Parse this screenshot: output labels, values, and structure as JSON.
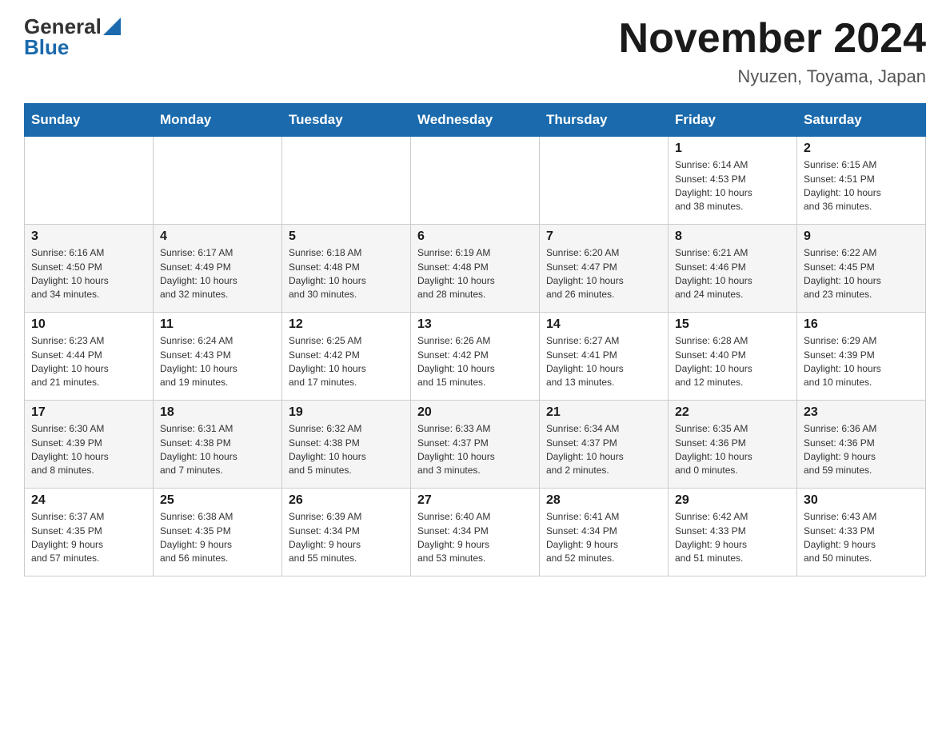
{
  "header": {
    "logo_general": "General",
    "logo_blue": "Blue",
    "month_title": "November 2024",
    "location": "Nyuzen, Toyama, Japan"
  },
  "days_of_week": [
    "Sunday",
    "Monday",
    "Tuesday",
    "Wednesday",
    "Thursday",
    "Friday",
    "Saturday"
  ],
  "weeks": [
    [
      {
        "day": "",
        "info": ""
      },
      {
        "day": "",
        "info": ""
      },
      {
        "day": "",
        "info": ""
      },
      {
        "day": "",
        "info": ""
      },
      {
        "day": "",
        "info": ""
      },
      {
        "day": "1",
        "info": "Sunrise: 6:14 AM\nSunset: 4:53 PM\nDaylight: 10 hours\nand 38 minutes."
      },
      {
        "day": "2",
        "info": "Sunrise: 6:15 AM\nSunset: 4:51 PM\nDaylight: 10 hours\nand 36 minutes."
      }
    ],
    [
      {
        "day": "3",
        "info": "Sunrise: 6:16 AM\nSunset: 4:50 PM\nDaylight: 10 hours\nand 34 minutes."
      },
      {
        "day": "4",
        "info": "Sunrise: 6:17 AM\nSunset: 4:49 PM\nDaylight: 10 hours\nand 32 minutes."
      },
      {
        "day": "5",
        "info": "Sunrise: 6:18 AM\nSunset: 4:48 PM\nDaylight: 10 hours\nand 30 minutes."
      },
      {
        "day": "6",
        "info": "Sunrise: 6:19 AM\nSunset: 4:48 PM\nDaylight: 10 hours\nand 28 minutes."
      },
      {
        "day": "7",
        "info": "Sunrise: 6:20 AM\nSunset: 4:47 PM\nDaylight: 10 hours\nand 26 minutes."
      },
      {
        "day": "8",
        "info": "Sunrise: 6:21 AM\nSunset: 4:46 PM\nDaylight: 10 hours\nand 24 minutes."
      },
      {
        "day": "9",
        "info": "Sunrise: 6:22 AM\nSunset: 4:45 PM\nDaylight: 10 hours\nand 23 minutes."
      }
    ],
    [
      {
        "day": "10",
        "info": "Sunrise: 6:23 AM\nSunset: 4:44 PM\nDaylight: 10 hours\nand 21 minutes."
      },
      {
        "day": "11",
        "info": "Sunrise: 6:24 AM\nSunset: 4:43 PM\nDaylight: 10 hours\nand 19 minutes."
      },
      {
        "day": "12",
        "info": "Sunrise: 6:25 AM\nSunset: 4:42 PM\nDaylight: 10 hours\nand 17 minutes."
      },
      {
        "day": "13",
        "info": "Sunrise: 6:26 AM\nSunset: 4:42 PM\nDaylight: 10 hours\nand 15 minutes."
      },
      {
        "day": "14",
        "info": "Sunrise: 6:27 AM\nSunset: 4:41 PM\nDaylight: 10 hours\nand 13 minutes."
      },
      {
        "day": "15",
        "info": "Sunrise: 6:28 AM\nSunset: 4:40 PM\nDaylight: 10 hours\nand 12 minutes."
      },
      {
        "day": "16",
        "info": "Sunrise: 6:29 AM\nSunset: 4:39 PM\nDaylight: 10 hours\nand 10 minutes."
      }
    ],
    [
      {
        "day": "17",
        "info": "Sunrise: 6:30 AM\nSunset: 4:39 PM\nDaylight: 10 hours\nand 8 minutes."
      },
      {
        "day": "18",
        "info": "Sunrise: 6:31 AM\nSunset: 4:38 PM\nDaylight: 10 hours\nand 7 minutes."
      },
      {
        "day": "19",
        "info": "Sunrise: 6:32 AM\nSunset: 4:38 PM\nDaylight: 10 hours\nand 5 minutes."
      },
      {
        "day": "20",
        "info": "Sunrise: 6:33 AM\nSunset: 4:37 PM\nDaylight: 10 hours\nand 3 minutes."
      },
      {
        "day": "21",
        "info": "Sunrise: 6:34 AM\nSunset: 4:37 PM\nDaylight: 10 hours\nand 2 minutes."
      },
      {
        "day": "22",
        "info": "Sunrise: 6:35 AM\nSunset: 4:36 PM\nDaylight: 10 hours\nand 0 minutes."
      },
      {
        "day": "23",
        "info": "Sunrise: 6:36 AM\nSunset: 4:36 PM\nDaylight: 9 hours\nand 59 minutes."
      }
    ],
    [
      {
        "day": "24",
        "info": "Sunrise: 6:37 AM\nSunset: 4:35 PM\nDaylight: 9 hours\nand 57 minutes."
      },
      {
        "day": "25",
        "info": "Sunrise: 6:38 AM\nSunset: 4:35 PM\nDaylight: 9 hours\nand 56 minutes."
      },
      {
        "day": "26",
        "info": "Sunrise: 6:39 AM\nSunset: 4:34 PM\nDaylight: 9 hours\nand 55 minutes."
      },
      {
        "day": "27",
        "info": "Sunrise: 6:40 AM\nSunset: 4:34 PM\nDaylight: 9 hours\nand 53 minutes."
      },
      {
        "day": "28",
        "info": "Sunrise: 6:41 AM\nSunset: 4:34 PM\nDaylight: 9 hours\nand 52 minutes."
      },
      {
        "day": "29",
        "info": "Sunrise: 6:42 AM\nSunset: 4:33 PM\nDaylight: 9 hours\nand 51 minutes."
      },
      {
        "day": "30",
        "info": "Sunrise: 6:43 AM\nSunset: 4:33 PM\nDaylight: 9 hours\nand 50 minutes."
      }
    ]
  ]
}
